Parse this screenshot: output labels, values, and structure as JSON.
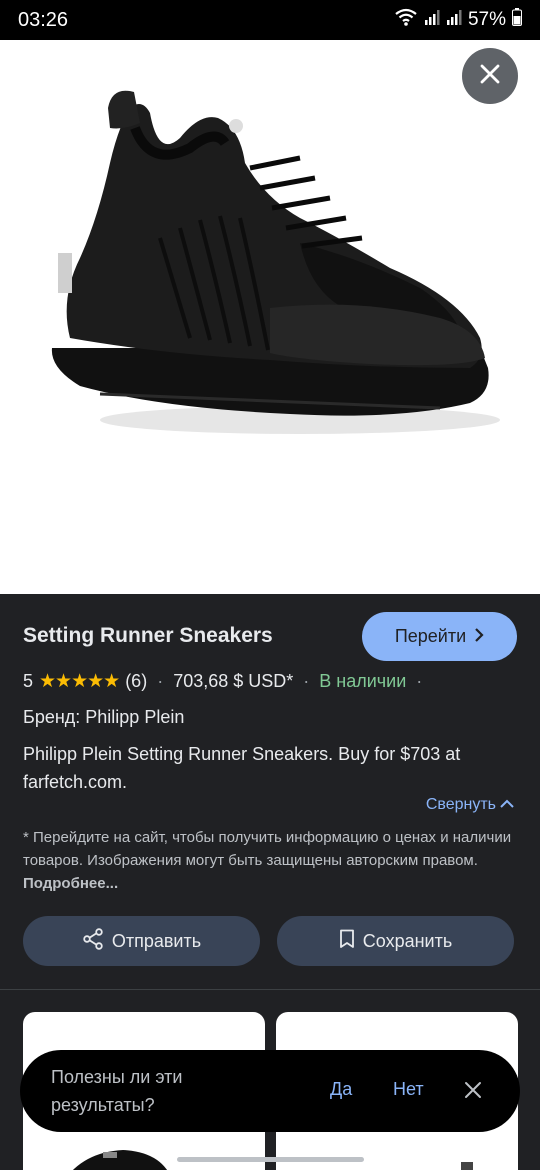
{
  "status_bar": {
    "time": "03:26",
    "battery": "57%"
  },
  "product": {
    "title": "Setting Runner Sneakers",
    "go_button": "Перейти",
    "rating_value": "5",
    "stars": "★★★★★",
    "review_count": "(6)",
    "price": "703,68 $ USD*",
    "availability": "В наличии",
    "brand": "Бренд: Philipp Plein",
    "description": "Philipp Plein Setting Runner Sneakers. Buy for $703 at farfetch.com.",
    "collapse_label": "Свернуть",
    "note": "* Перейдите на сайт, чтобы получить информацию о ценах и наличии товаров. Изображения могут быть защищены авторским правом.",
    "note_more": "Подробнее...",
    "share_label": "Отправить",
    "save_label": "Сохранить"
  },
  "feedback": {
    "question": "Полезны ли эти результаты?",
    "yes": "Да",
    "no": "Нет"
  },
  "colors": {
    "accent": "#8ab4f8",
    "star": "#fbbc04",
    "in_stock": "#81c995",
    "background": "#202124",
    "button_bg": "#394457"
  },
  "icons": [
    "wifi-icon",
    "signal-icon",
    "battery-icon",
    "close-icon",
    "chevron-right-icon",
    "chevron-up-icon",
    "share-icon",
    "bookmark-icon"
  ]
}
